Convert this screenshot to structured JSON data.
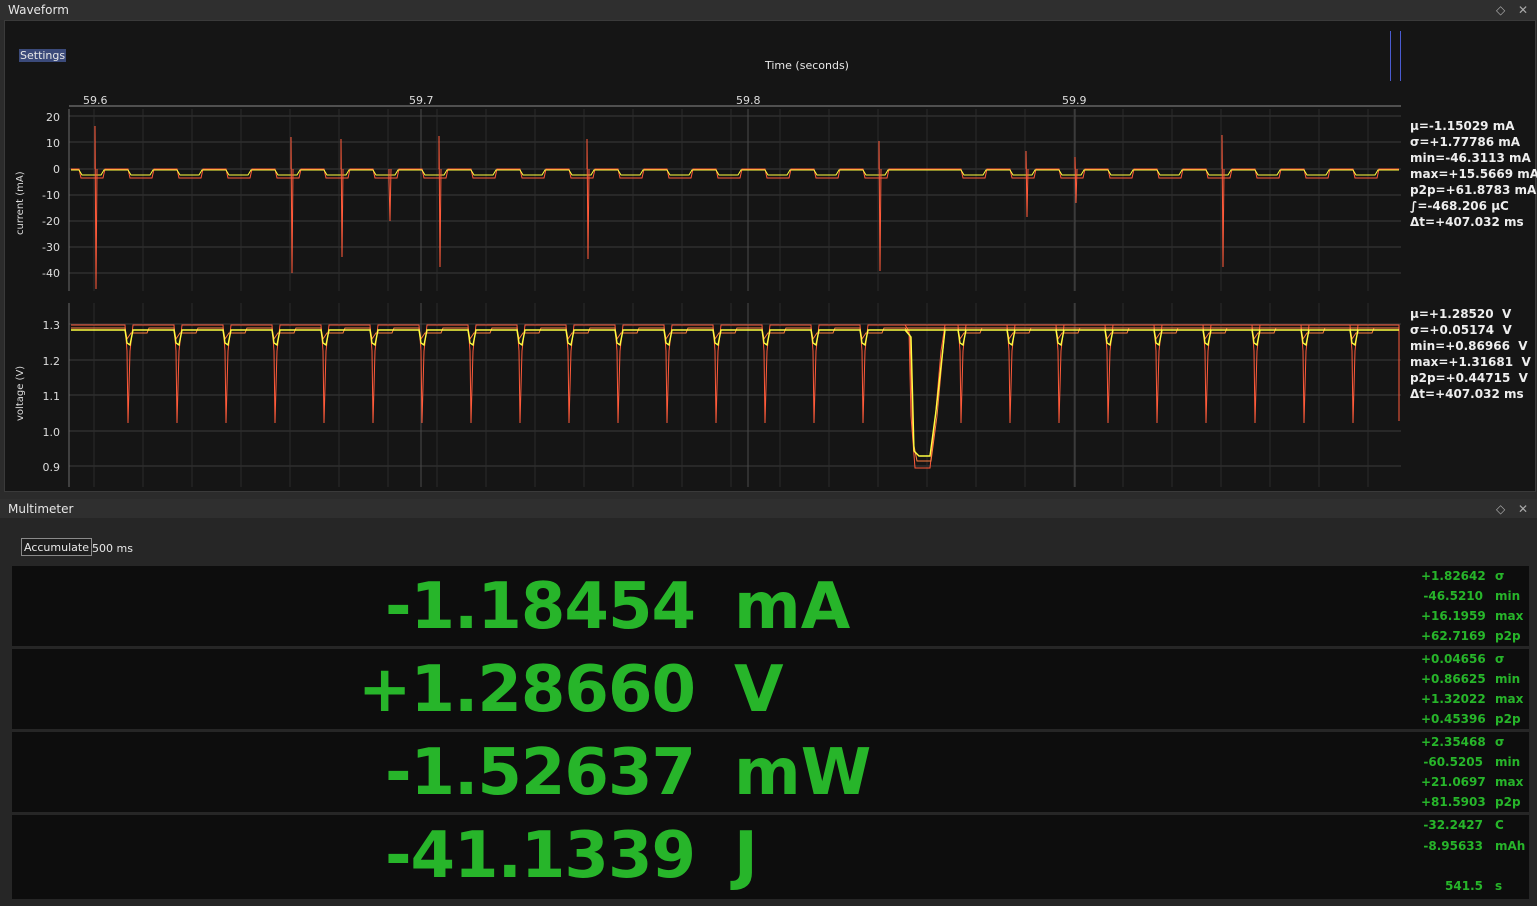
{
  "waveform": {
    "title": "Waveform",
    "settings_label": "Settings",
    "time_axis_label": "Time (seconds)",
    "time_ticks": [
      "59.6",
      "59.7",
      "59.8",
      "59.9"
    ],
    "current": {
      "ylabel": "current (mA)",
      "ticks": [
        "20",
        "10",
        "0",
        "-10",
        "-20",
        "-30",
        "-40"
      ],
      "stats": [
        "μ=-1.15029 mA",
        "σ=+1.77786 mA",
        "min=-46.3113 mA",
        "max=+15.5669 mA",
        "p2p=+61.8783 mA",
        "∫=-468.206 μC",
        "Δt=+407.032 ms"
      ]
    },
    "voltage": {
      "ylabel": "voltage (V)",
      "ticks": [
        "1.3",
        "1.2",
        "1.1",
        "1.0",
        "0.9"
      ],
      "stats": [
        "μ=+1.28520  V",
        "σ=+0.05174  V",
        "min=+0.86966  V",
        "max=+1.31681  V",
        "p2p=+0.44715  V",
        "Δt=+407.032 ms"
      ]
    },
    "colors": {
      "min_max": "#ff5a3a",
      "mean": "#ffff40",
      "grid": "#3c3c3c"
    }
  },
  "multimeter": {
    "title": "Multimeter",
    "accumulate_label": "Accumulate",
    "window_label": "500 ms",
    "rows": [
      {
        "value": "-1.18454",
        "unit": "mA",
        "stats": [
          {
            "v": "+1.82642",
            "l": "σ"
          },
          {
            "v": "-46.5210",
            "l": "min"
          },
          {
            "v": "+16.1959",
            "l": "max"
          },
          {
            "v": "+62.7169",
            "l": "p2p"
          }
        ]
      },
      {
        "value": "+1.28660",
        "unit": "V",
        "stats": [
          {
            "v": "+0.04656",
            "l": "σ"
          },
          {
            "v": "+0.86625",
            "l": "min"
          },
          {
            "v": "+1.32022",
            "l": "max"
          },
          {
            "v": "+0.45396",
            "l": "p2p"
          }
        ]
      },
      {
        "value": "-1.52637",
        "unit": "mW",
        "stats": [
          {
            "v": "+2.35468",
            "l": "σ"
          },
          {
            "v": "-60.5205",
            "l": "min"
          },
          {
            "v": "+21.0697",
            "l": "max"
          },
          {
            "v": "+81.5903",
            "l": "p2p"
          }
        ]
      },
      {
        "value": "-41.1339",
        "unit": "J",
        "stats": [
          {
            "v": "-32.2427",
            "l": "C"
          },
          {
            "v": "-8.95633",
            "l": "mAh"
          },
          {
            "v": "541.5",
            "l": "s"
          }
        ]
      }
    ],
    "accent": "#27b52a"
  },
  "icons": {
    "float": "diamond-icon",
    "close": "close-icon"
  }
}
